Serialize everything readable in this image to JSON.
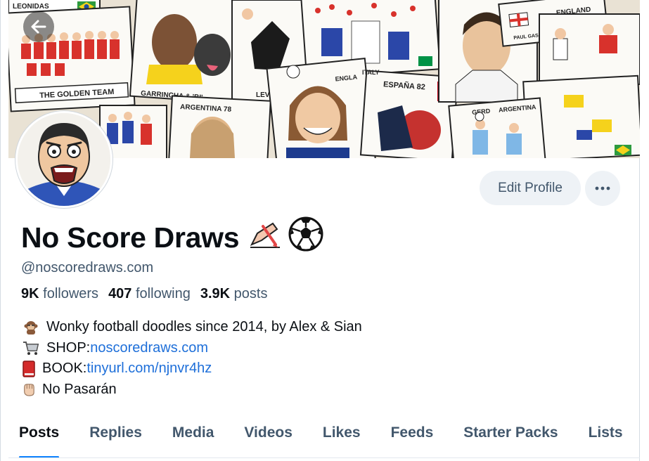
{
  "profile": {
    "display_name": "No Score Draws",
    "name_emojis": [
      "pencil-writing-emoji",
      "soccer-ball-emoji"
    ],
    "handle": "@noscoredraws.com",
    "stats": {
      "followers_count": "9K",
      "followers_label": "followers",
      "following_count": "407",
      "following_label": "following",
      "posts_count": "3.9K",
      "posts_label": "posts"
    },
    "bio": [
      {
        "icon": "monkey-emoji",
        "text": "Wonky football doodles since 2014, by Alex & Sian",
        "link": ""
      },
      {
        "icon": "shopping-cart-emoji",
        "text": "SHOP: ",
        "link": "noscoredraws.com"
      },
      {
        "icon": "red-book-emoji",
        "text": "BOOK: ",
        "link": "tinyurl.com/njnvr4hz"
      },
      {
        "icon": "raised-fist-emoji",
        "text": "No Pasarán",
        "link": ""
      }
    ]
  },
  "actions": {
    "edit_profile_label": "Edit Profile",
    "more_label": "···"
  },
  "banner": {
    "card_labels": [
      "LEONIDAS",
      "THE GOLDEN TEAM",
      "GARRINCHA & 'BI'",
      "LEV YASHIN",
      "ARGENTINA 78",
      "ENGLA",
      "ITALY",
      "ESPAÑA 82",
      "ENGLAND",
      "PAUL GASCOIGNE & GARY LINEKER",
      "GERD",
      "ARGENTINA"
    ]
  },
  "tabs": [
    {
      "label": "Posts",
      "active": true
    },
    {
      "label": "Replies",
      "active": false
    },
    {
      "label": "Media",
      "active": false
    },
    {
      "label": "Videos",
      "active": false
    },
    {
      "label": "Likes",
      "active": false
    },
    {
      "label": "Feeds",
      "active": false
    },
    {
      "label": "Starter Packs",
      "active": false
    },
    {
      "label": "Lists",
      "active": false
    }
  ],
  "colors": {
    "link": "#1e6fd9",
    "tab_indicator": "#1083fe",
    "muted_text": "#42576c",
    "button_bg": "#eef2f6"
  }
}
